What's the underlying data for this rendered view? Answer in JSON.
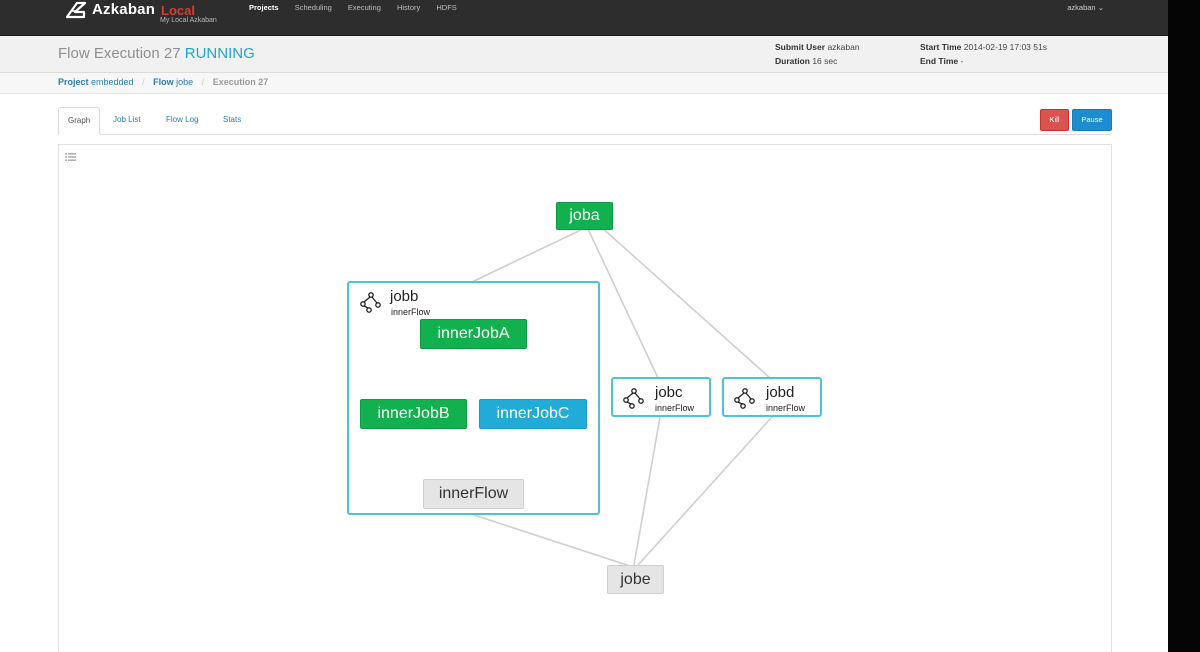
{
  "navbar": {
    "brand": "Azkaban",
    "env": "Local",
    "subtitle": "My Local Azkaban",
    "links": [
      "Projects",
      "Scheduling",
      "Executing",
      "History",
      "HDFS"
    ],
    "user": "azkaban"
  },
  "header": {
    "title": "Flow Execution 27",
    "status": "RUNNING",
    "submit_user_label": "Submit User",
    "submit_user": "azkaban",
    "duration_label": "Duration",
    "duration": "16 sec",
    "start_time_label": "Start Time",
    "start_time": "2014-02-19 17:03 51s",
    "end_time_label": "End Time",
    "end_time": "-"
  },
  "breadcrumb": {
    "project_label": "Project",
    "project": "embedded",
    "flow_label": "Flow",
    "flow": "jobe",
    "execution": "Execution 27"
  },
  "tabs": [
    "Graph",
    "Job List",
    "Flow Log",
    "Stats"
  ],
  "buttons": {
    "kill": "Kill",
    "pause": "Pause"
  },
  "graph": {
    "jobs": {
      "joba": "joba",
      "jobe": "jobe",
      "innerJobA": "innerJobA",
      "innerJobB": "innerJobB",
      "innerJobC": "innerJobC",
      "innerFlow": "innerFlow"
    },
    "flows": {
      "jobb": {
        "name": "jobb",
        "type": "innerFlow"
      },
      "jobc": {
        "name": "jobc",
        "type": "innerFlow"
      },
      "jobd": {
        "name": "jobd",
        "type": "innerFlow"
      }
    },
    "status_colors": {
      "succeeded": "#13b04f",
      "running": "#21acd7",
      "ready": "#e5e5e5",
      "flow_border": "#4cc3d9"
    }
  }
}
